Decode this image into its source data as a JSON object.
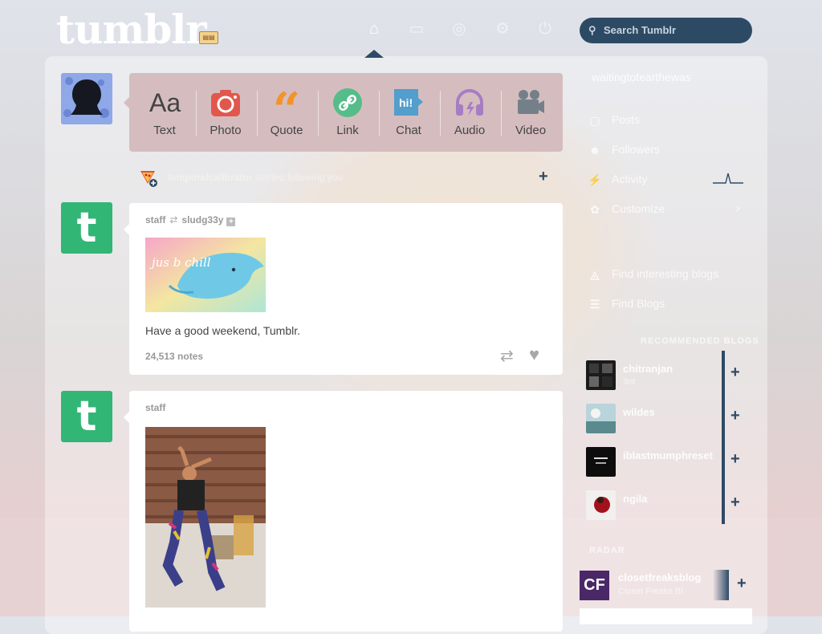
{
  "header": {
    "logo": "tumblr",
    "nav": [
      {
        "name": "home-icon",
        "glyph": "⌂"
      },
      {
        "name": "inbox-icon",
        "glyph": "▭"
      },
      {
        "name": "explore-icon",
        "glyph": "◎"
      },
      {
        "name": "settings-icon",
        "glyph": "⚙"
      },
      {
        "name": "power-icon",
        "glyph": "⏻"
      }
    ],
    "search_placeholder": "Search Tumblr"
  },
  "post_types": [
    {
      "label": "Text",
      "color": "#444444",
      "icon": "text-icon"
    },
    {
      "label": "Photo",
      "color": "#e2574c",
      "icon": "camera-icon"
    },
    {
      "label": "Quote",
      "color": "#f2932d",
      "icon": "quote-icon"
    },
    {
      "label": "Link",
      "color": "#56bc8a",
      "icon": "link-icon"
    },
    {
      "label": "Chat",
      "color": "#529ecc",
      "icon": "chat-icon"
    },
    {
      "label": "Audio",
      "color": "#a77dc2",
      "icon": "headphones-icon"
    },
    {
      "label": "Video",
      "color": "#748089",
      "icon": "video-camera-icon"
    }
  ],
  "activity": {
    "user": "temporalcalibrator",
    "action": "started following you"
  },
  "posts": [
    {
      "author": "staff",
      "reblogged_from": "sludg33y",
      "image_text": "jus b chill",
      "caption": "Have a good weekend, Tumblr.",
      "notes": "24,513 notes"
    },
    {
      "author": "staff"
    }
  ],
  "sidebar": {
    "blog_name": "waitingtotearthewas",
    "items": [
      {
        "label": "Posts",
        "icon": "document-icon"
      },
      {
        "label": "Followers",
        "icon": "people-icon"
      },
      {
        "label": "Activity",
        "icon": "lightning-icon"
      },
      {
        "label": "Customize",
        "icon": "palette-icon"
      }
    ],
    "links": [
      {
        "label": "Find interesting blogs",
        "icon": "compass-icon"
      },
      {
        "label": "Find Blogs",
        "icon": "search-list-icon"
      }
    ],
    "section_title": "RECOMMENDED BLOGS",
    "recommended": [
      {
        "name": "chitranjan",
        "sub": "3nt"
      },
      {
        "name": "wildes",
        "sub": ""
      },
      {
        "name": "iblastmumphreset",
        "sub": ""
      },
      {
        "name": "ngila",
        "sub": ""
      }
    ],
    "radar_title": "RADAR",
    "radar": {
      "name": "closetfreaksblog",
      "sub": "Closet Freaks Bl",
      "initials": "CF"
    }
  },
  "colors": {
    "nav_accent": "#2f4a66",
    "tumblr_green": "#31b676"
  }
}
